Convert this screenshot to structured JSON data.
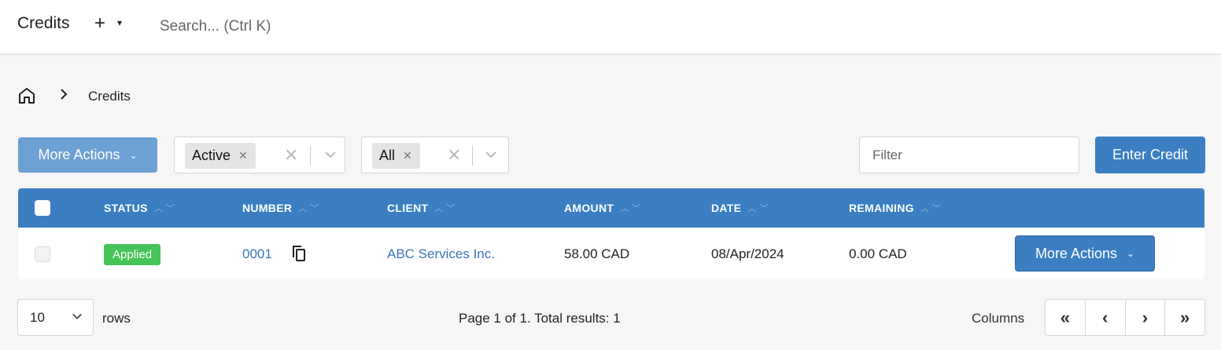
{
  "header": {
    "title": "Credits",
    "add_icon": "+",
    "caret": "▾",
    "search_placeholder": "Search... (Ctrl K)"
  },
  "breadcrumb": {
    "separator": "›",
    "current": "Credits"
  },
  "toolbar": {
    "more_actions": "More Actions",
    "status_filter": {
      "chip": "Active"
    },
    "type_filter": {
      "chip": "All"
    },
    "filter_placeholder": "Filter",
    "enter_credit": "Enter Credit"
  },
  "table": {
    "columns": [
      "STATUS",
      "NUMBER",
      "CLIENT",
      "AMOUNT",
      "DATE",
      "REMAINING"
    ],
    "sort_icons": "^ ˅",
    "rows": [
      {
        "status": "Applied",
        "number": "0001",
        "client": "ABC Services Inc.",
        "amount": "58.00 CAD",
        "date": "08/Apr/2024",
        "remaining": "0.00 CAD",
        "action": "More Actions"
      }
    ],
    "status_color": "#44c455"
  },
  "footer": {
    "rows_per_page": "10",
    "rows_label": "rows",
    "page_info": "Page 1 of 1. Total results: 1",
    "columns": "Columns",
    "pager": [
      "«",
      "‹",
      "›",
      "»"
    ]
  }
}
